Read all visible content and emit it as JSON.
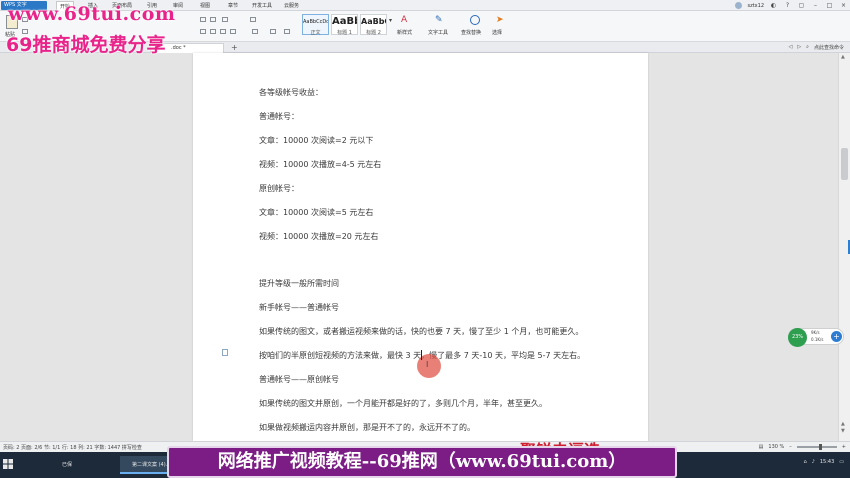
{
  "menubar": {
    "app": "WPS 文字",
    "menus": [
      "开始",
      "插入",
      "页面布局",
      "引用",
      "审阅",
      "视图",
      "章节",
      "开发工具",
      "云服务"
    ],
    "user": "sztx12"
  },
  "ribbon": {
    "paste": "粘贴",
    "styles": [
      {
        "sample": "AaBbCcDd",
        "caption": "正文"
      },
      {
        "sample": "AaBb",
        "caption": "标题 1"
      },
      {
        "sample": "AaBbC",
        "caption": "标题 2"
      }
    ],
    "new_style": "新样式",
    "text_tools": "文字工具",
    "find_replace": "查找替换",
    "select": "选择"
  },
  "tabs": {
    "doc_tab": ".doc *",
    "right_hint": "点此查找命令"
  },
  "document": {
    "lines": [
      "各等级帐号收益：",
      "普通帐号：",
      "文章：10000 次阅读=2 元以下",
      "视频：10000 次播放=4-5 元左右",
      "原创帐号：",
      "文章：10000 次阅读=5 元左右",
      "视频：10000 次播放=20 元左右",
      "提升等级一般所需时间",
      "新手帐号——普通帐号",
      "如果传统的图文，或者搬运视频来做的话，快的也要 7 天，慢了至少 1 个月，也可能更久。",
      "按咱们的半原创短视频的方法来做，最快 3 天，慢了最多 7 天-10 天，平均是 5-7 天左右。",
      "普通帐号——原创帐号",
      "如果传统的图文并原创，一个月能开都是好的了，多则几个月，半年，甚至更久。",
      "如果做视频搬运内容并原创，那是开不了的，永远开不了的。"
    ]
  },
  "speed_widget": {
    "percent": "23%",
    "up": "9K/s",
    "down": "0.1K/s"
  },
  "status": {
    "left": "页码: 2  页面: 2/6  节: 1/1  行: 18  列: 21  字数: 1447  拼写检查",
    "zoom": "130 %"
  },
  "taskbar": {
    "items": [
      "已保",
      "第二课文案 (4)..."
    ],
    "time": "15:43"
  },
  "watermarks": {
    "url": "www.69tui.com",
    "cn": "69推商城免费分享",
    "banner": "网络推广视频教程--69推网（www.69tui.com）",
    "red": "聚锐电逗选"
  }
}
